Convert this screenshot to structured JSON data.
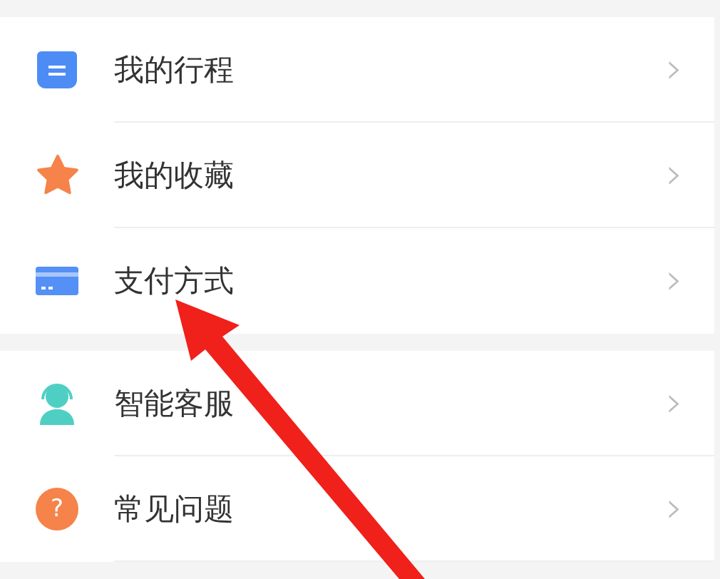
{
  "groups": [
    {
      "items": [
        {
          "label": "我的行程",
          "kind": "list",
          "chevron": "›"
        },
        {
          "label": "我的收藏",
          "kind": "star",
          "chevron": "›"
        },
        {
          "label": "支付方式",
          "kind": "card",
          "chevron": "›"
        }
      ]
    },
    {
      "items": [
        {
          "label": "智能客服",
          "kind": "support",
          "chevron": "›"
        },
        {
          "label": "常见问题",
          "kind": "help",
          "icon_text": "?",
          "chevron": "›"
        }
      ]
    }
  ],
  "annotation": {
    "kind": "arrow"
  }
}
